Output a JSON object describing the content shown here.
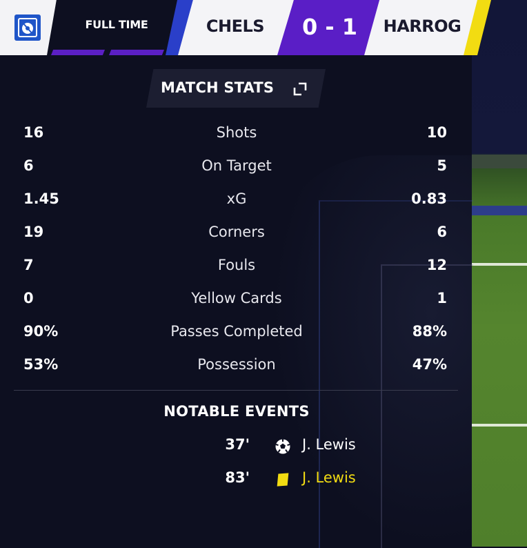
{
  "header": {
    "status": "FULL TIME",
    "home_team": "CHELS",
    "away_team": "HARROG",
    "score": "0 - 1",
    "colors": {
      "home": "#2a3fc9",
      "away": "#f2dc12",
      "score_bg": "#5a1ec6"
    }
  },
  "match_stats": {
    "title": "MATCH STATS",
    "rows": [
      {
        "label": "Shots",
        "home": "16",
        "away": "10"
      },
      {
        "label": "On Target",
        "home": "6",
        "away": "5"
      },
      {
        "label": "xG",
        "home": "1.45",
        "away": "0.83"
      },
      {
        "label": "Corners",
        "home": "19",
        "away": "6"
      },
      {
        "label": "Fouls",
        "home": "7",
        "away": "12"
      },
      {
        "label": "Yellow Cards",
        "home": "0",
        "away": "1"
      },
      {
        "label": "Passes Completed",
        "home": "90%",
        "away": "88%"
      },
      {
        "label": "Possession",
        "home": "53%",
        "away": "47%"
      }
    ]
  },
  "notable_events": {
    "title": "NOTABLE EVENTS",
    "events": [
      {
        "minute": "37'",
        "icon": "goal-ball-icon",
        "player": "J. Lewis",
        "type": "goal"
      },
      {
        "minute": "83'",
        "icon": "yellow-card-icon",
        "player": "J. Lewis",
        "type": "yellow_card"
      }
    ]
  }
}
